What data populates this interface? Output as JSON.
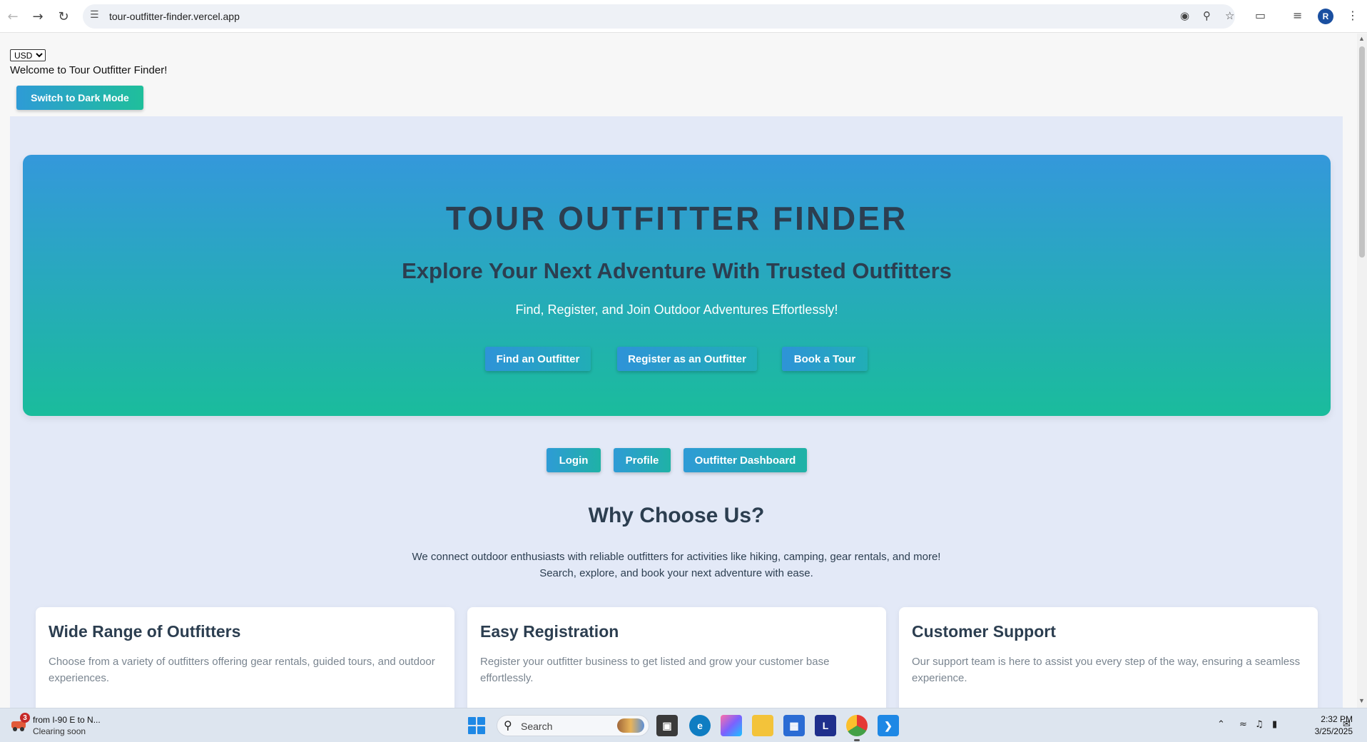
{
  "browser": {
    "url": "tour-outfitter-finder.vercel.app",
    "profile_initial": "R",
    "icons": [
      "back-icon",
      "forward-icon",
      "reload-icon",
      "site-info-icon",
      "eye-off-icon",
      "zoom-icon",
      "star-icon",
      "extensions-icon",
      "tab-search-icon",
      "menu-icon"
    ]
  },
  "page": {
    "currency": {
      "selected": "USD",
      "options": [
        "USD"
      ]
    },
    "welcome_text": "Welcome to Tour Outfitter Finder!",
    "dark_mode_button": "Switch to Dark Mode",
    "hero": {
      "title": "TOUR OUTFITTER FINDER",
      "subtitle": "Explore Your Next Adventure With Trusted Outfitters",
      "tagline": "Find, Register, and Join Outdoor Adventures Effortlessly!",
      "buttons": {
        "find": "Find an Outfitter",
        "register": "Register as an Outfitter",
        "book": "Book a Tour"
      }
    },
    "nav_buttons": {
      "login": "Login",
      "profile": "Profile",
      "dashboard": "Outfitter Dashboard"
    },
    "why": {
      "title": "Why Choose Us?",
      "line1": "We connect outdoor enthusiasts with reliable outfitters for activities like hiking, camping, gear rentals, and more!",
      "line2": "Search, explore, and book your next adventure with ease."
    },
    "cards": [
      {
        "title": "Wide Range of Outfitters",
        "text": "Choose from a variety of outfitters offering gear rentals, guided tours, and outdoor experiences."
      },
      {
        "title": "Easy Registration",
        "text": "Register your outfitter business to get listed and grow your customer base effortlessly."
      },
      {
        "title": "Customer Support",
        "text": "Our support team is here to assist you every step of the way, ensuring a seamless experience."
      }
    ]
  },
  "taskbar": {
    "weather_badge": "3",
    "weather_title": "from I-90 E to N...",
    "weather_sub": "Clearing soon",
    "search_placeholder": "Search",
    "time": "2:32 PM",
    "date": "3/25/2025",
    "apps": [
      "file-explorer-icon",
      "edge-icon",
      "copilot-icon",
      "folder-icon",
      "store-icon",
      "l-app-icon",
      "chrome-icon",
      "vscode-icon"
    ]
  },
  "colors": {
    "hero_top": "#3498db",
    "hero_bottom": "#1abc9c",
    "heading": "#2c3e50",
    "panel_bg": "#e3e9f7"
  }
}
